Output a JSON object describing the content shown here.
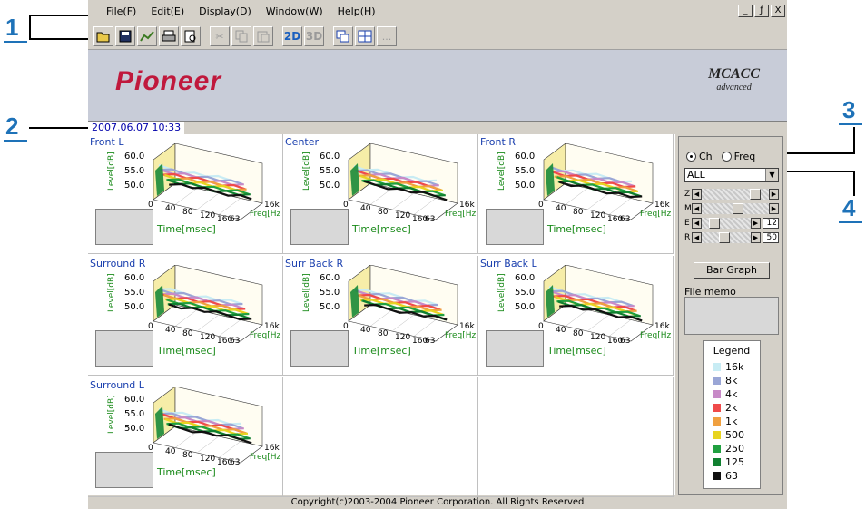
{
  "callouts": [
    "1",
    "2",
    "3",
    "4"
  ],
  "window": {
    "controls": [
      "_",
      "ƒ",
      "X"
    ]
  },
  "menu": [
    "File(F)",
    "Edit(E)",
    "Display(D)",
    "Window(W)",
    "Help(H)"
  ],
  "toolbar": {
    "open": "open-folder-icon",
    "save": "save-icon",
    "graph": "graph-icon",
    "print": "print-icon",
    "preview": "print-preview-icon",
    "cut": "cut-icon",
    "copy": "copy-icon",
    "paste": "paste-icon",
    "view2d": "2D",
    "view3d": "3D",
    "window1": "window-icon",
    "window2": "tile-icon",
    "more": "..."
  },
  "banner": {
    "logo": "Pioneer",
    "mcacc_main": "MCACC",
    "mcacc_sub": "advanced"
  },
  "datetime": "2007.06.07  10:33",
  "plot_labels": {
    "level": "Level[dB]",
    "y_ticks": [
      "60.0",
      "55.0",
      "50.0"
    ],
    "time_ticks": [
      "0",
      "40",
      "80",
      "120",
      "160"
    ],
    "freq_ticks": [
      "63",
      "16k"
    ],
    "freq": "Freq[Hz",
    "time": "Time[msec]"
  },
  "channels": [
    "Front L",
    "Center",
    "Front R",
    "Surround R",
    "Surr Back R",
    "Surr Back L",
    "Surround L"
  ],
  "panel": {
    "radio_ch": "Ch",
    "radio_freq": "Freq",
    "selected_radio": "Ch",
    "select_value": "ALL",
    "sliders": [
      {
        "label": "Z",
        "level": 0.85,
        "value": ""
      },
      {
        "label": "M",
        "level": 0.55,
        "value": ""
      },
      {
        "label": "E",
        "level": 0.2,
        "value": "12"
      },
      {
        "label": "R",
        "level": 0.45,
        "value": "50"
      }
    ],
    "bar_graph": "Bar Graph",
    "file_memo": "File memo"
  },
  "legend": {
    "title": "Legend",
    "items": [
      {
        "label": "16k",
        "color": "#c8ecf4"
      },
      {
        "label": "8k",
        "color": "#9aa6d6"
      },
      {
        "label": "4k",
        "color": "#c88ac8"
      },
      {
        "label": "2k",
        "color": "#f04a4a"
      },
      {
        "label": "1k",
        "color": "#f0a040"
      },
      {
        "label": "500",
        "color": "#e8d420"
      },
      {
        "label": "250",
        "color": "#20a040"
      },
      {
        "label": "125",
        "color": "#108030"
      },
      {
        "label": "63",
        "color": "#101010"
      }
    ]
  },
  "footer": "Copyright(c)2003-2004 Pioneer Corporation. All Rights Reserved"
}
